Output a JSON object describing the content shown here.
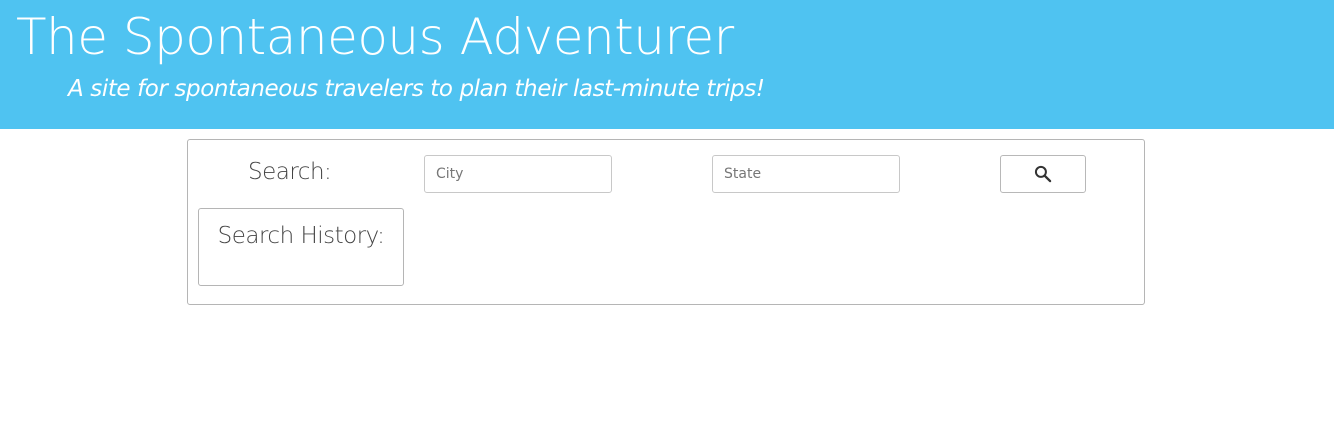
{
  "header": {
    "title": "The Spontaneous Adventurer",
    "subtitle": "A site for spontaneous travelers to plan their last-minute trips!",
    "background_color": "#4fc3f1"
  },
  "search": {
    "label": "Search:",
    "city_placeholder": "City",
    "city_value": "",
    "state_placeholder": "State",
    "state_value": "",
    "button_icon": "search-icon"
  },
  "history": {
    "label": "Search History:",
    "items": []
  }
}
